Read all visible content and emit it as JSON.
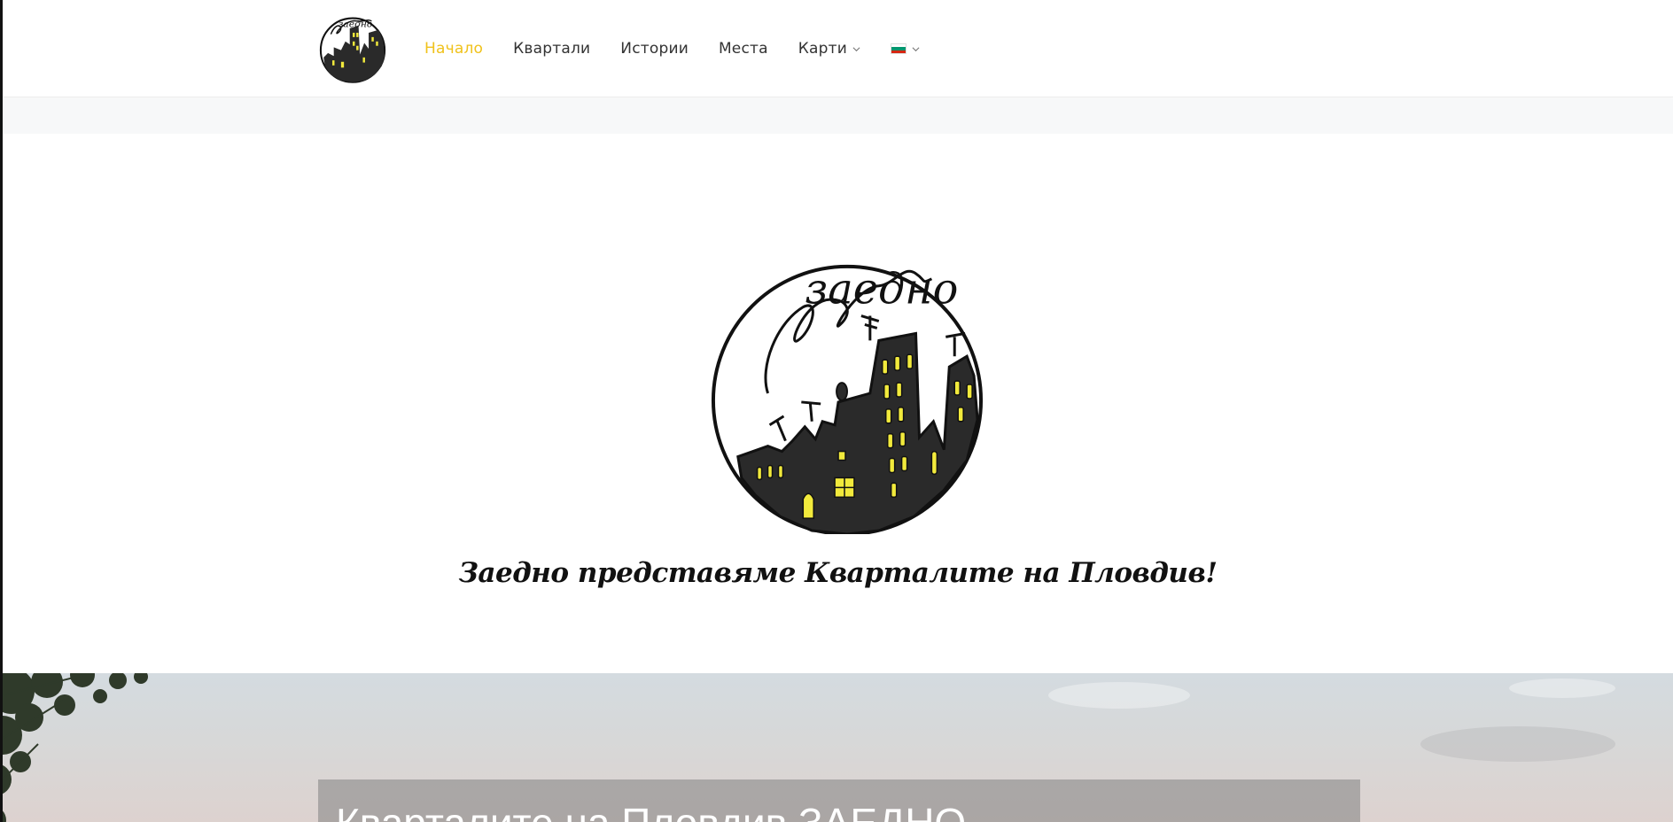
{
  "nav": {
    "items": [
      {
        "label": "Начало",
        "active": true
      },
      {
        "label": "Квартали"
      },
      {
        "label": "Истории"
      },
      {
        "label": "Места"
      },
      {
        "label": "Карти",
        "dropdown": true
      }
    ],
    "language_icon": "bulgarian-flag-icon"
  },
  "hero": {
    "logo_text": "заедно",
    "tagline": "Заедно представяме Кварталите на Пловдив!"
  },
  "section": {
    "title": "Кварталите на Пловдив ЗАЕДНО"
  },
  "colors": {
    "accent": "#f0c21b",
    "window_yellow": "#f2ea3c",
    "building_dark": "#2a2a2a"
  }
}
